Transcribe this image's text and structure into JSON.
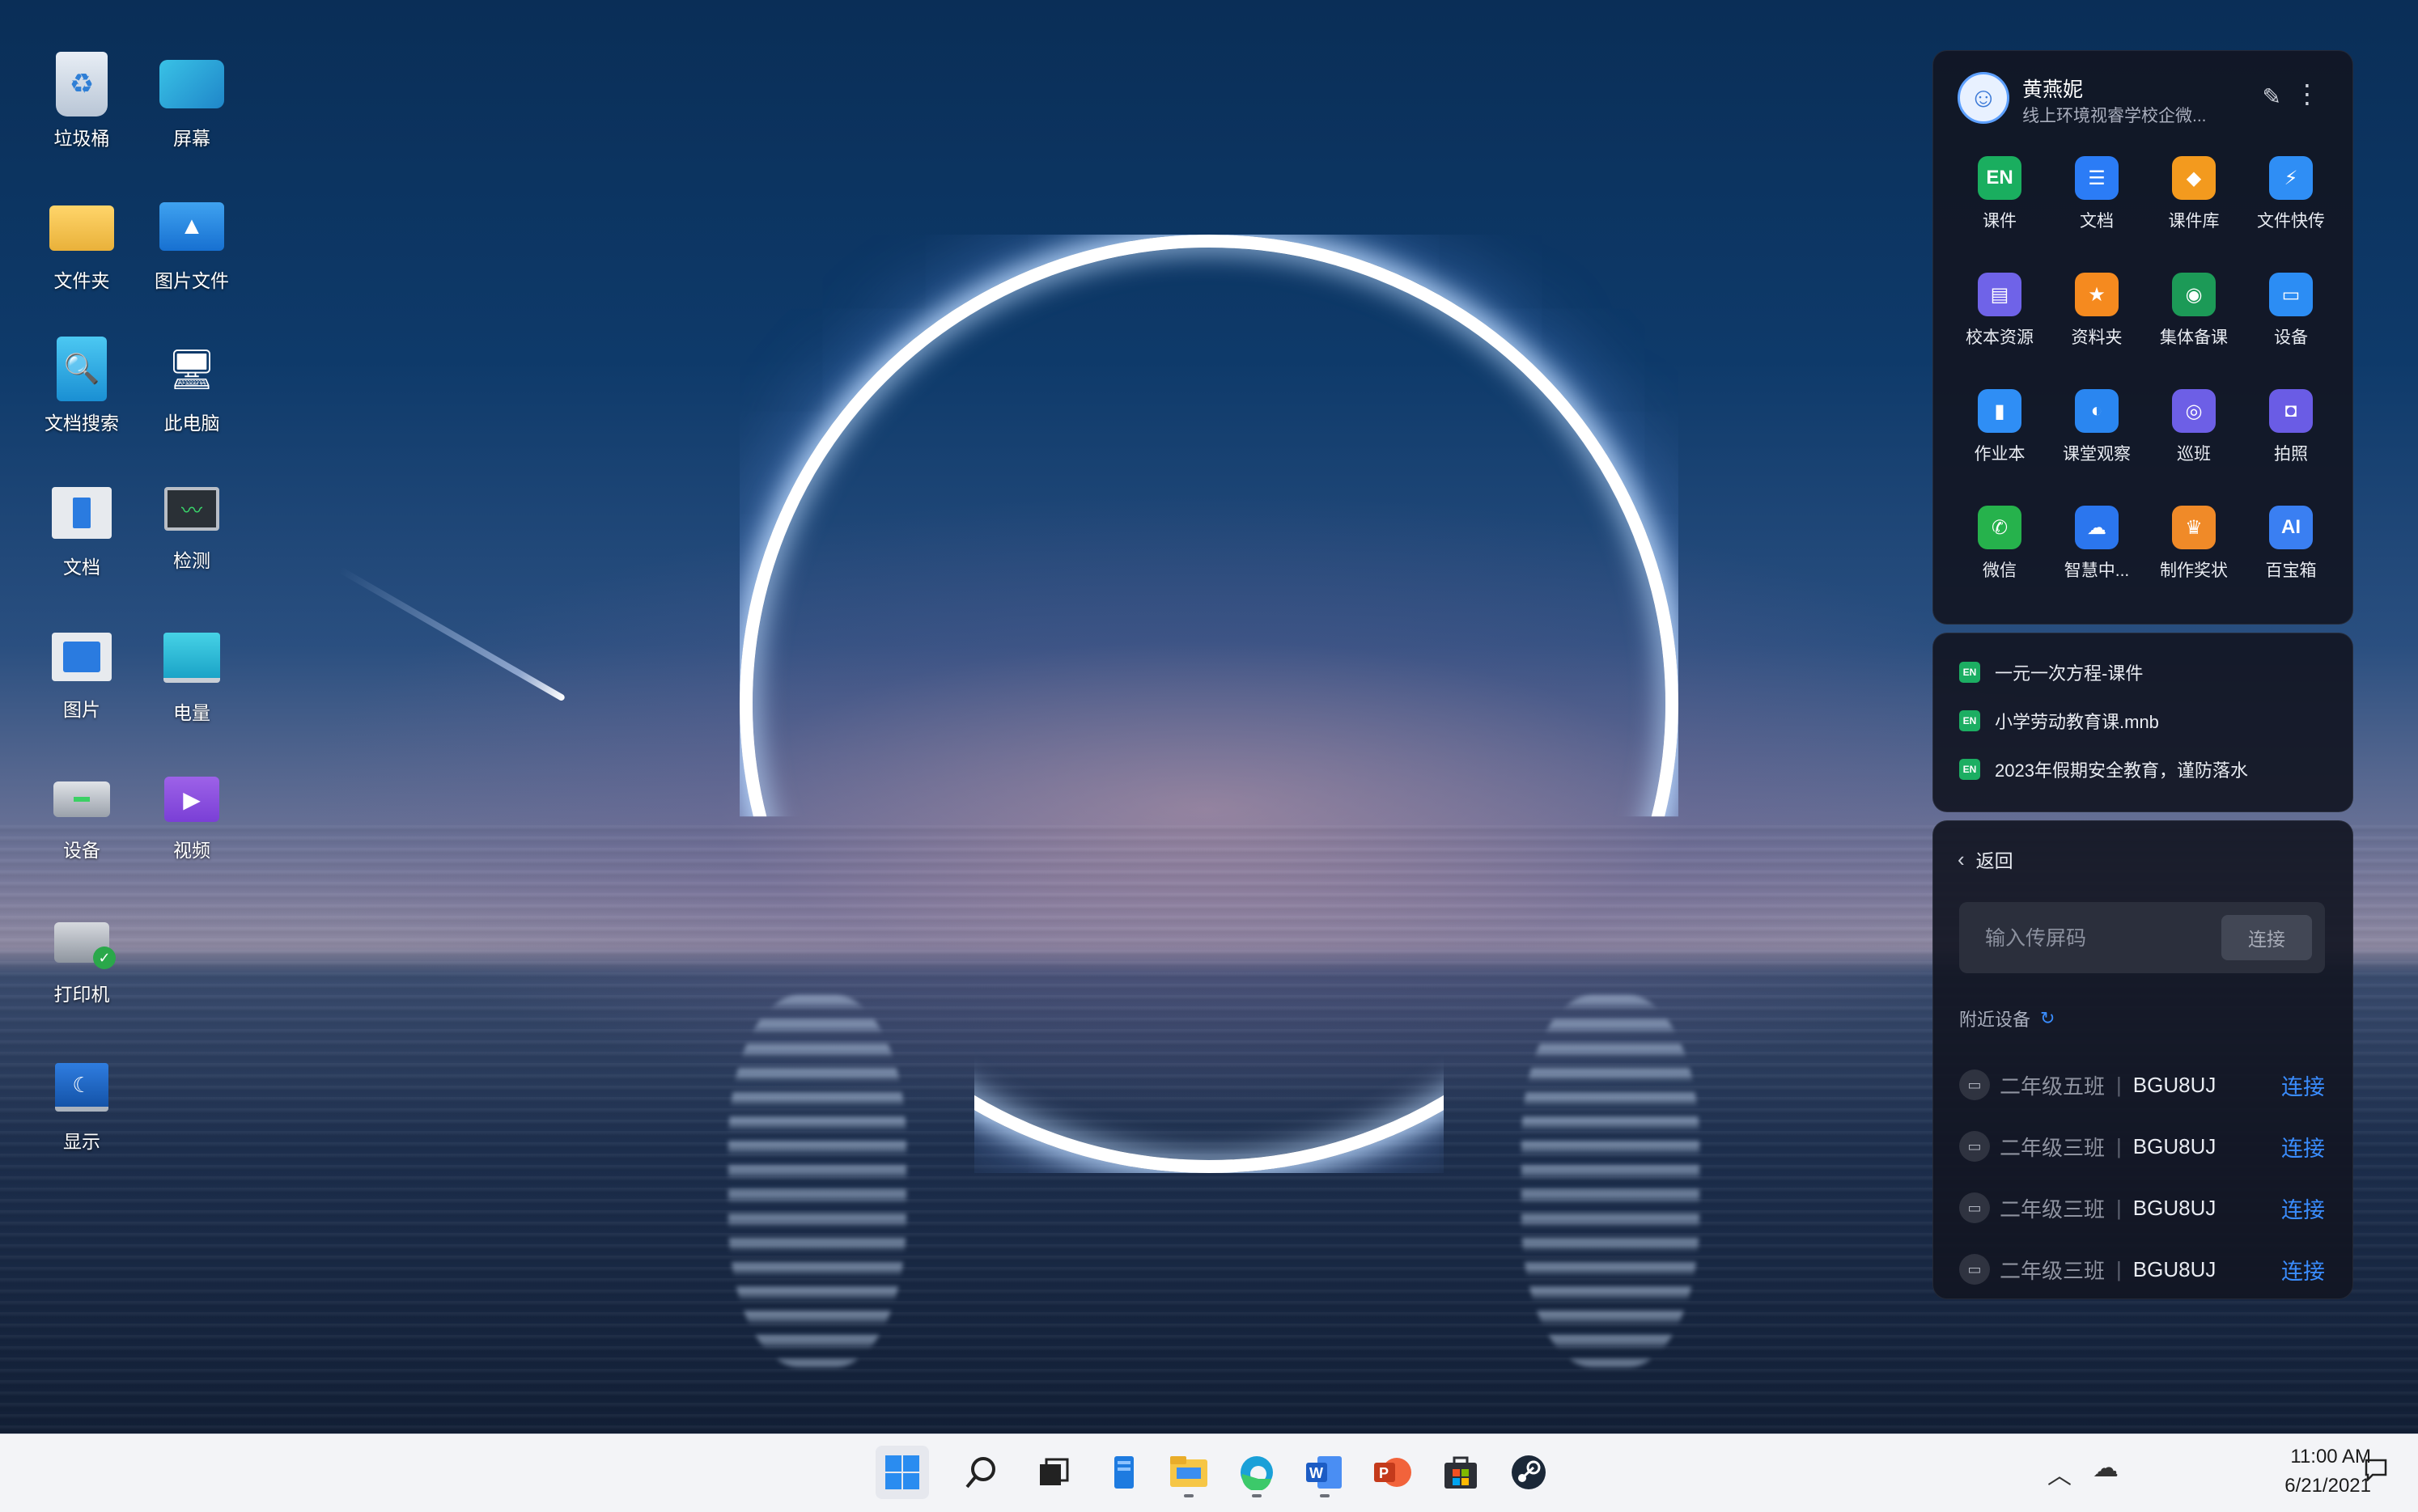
{
  "desktop_icons": [
    {
      "name": "recycle-bin",
      "label": "垃圾桶"
    },
    {
      "name": "screen",
      "label": "屏幕"
    },
    {
      "name": "folder",
      "label": "文件夹"
    },
    {
      "name": "pictures-folder",
      "label": "图片文件"
    },
    {
      "name": "doc-search",
      "label": "文档搜索"
    },
    {
      "name": "this-pc",
      "label": "此电脑"
    },
    {
      "name": "document",
      "label": "文档"
    },
    {
      "name": "monitor",
      "label": "检测"
    },
    {
      "name": "picture",
      "label": "图片"
    },
    {
      "name": "battery",
      "label": "电量"
    },
    {
      "name": "device",
      "label": "设备"
    },
    {
      "name": "video",
      "label": "视频"
    },
    {
      "name": "printer",
      "label": "打印机"
    },
    {
      "name": "display",
      "label": "显示"
    }
  ],
  "user": {
    "name": "黄燕妮",
    "org": "线上环境视睿学校企微...",
    "apps": [
      {
        "label": "课件",
        "glyph": "EN",
        "color": "#1aae5f"
      },
      {
        "label": "文档",
        "glyph": "☰",
        "color": "#2b7cf6"
      },
      {
        "label": "课件库",
        "glyph": "◆",
        "color": "#f39a1e"
      },
      {
        "label": "文件快传",
        "glyph": "⚡",
        "color": "#2f8ef5"
      },
      {
        "label": "校本资源",
        "glyph": "▤",
        "color": "#6f63e8"
      },
      {
        "label": "资料夹",
        "glyph": "★",
        "color": "#f58a1f"
      },
      {
        "label": "集体备课",
        "glyph": "◉",
        "color": "#1c9a57"
      },
      {
        "label": "设备",
        "glyph": "▭",
        "color": "#2c8df4"
      },
      {
        "label": "作业本",
        "glyph": "▮",
        "color": "#2f8ef5"
      },
      {
        "label": "课堂观察",
        "glyph": "◐",
        "color": "#2a86f0"
      },
      {
        "label": "巡班",
        "glyph": "◎",
        "color": "#6d5fe6"
      },
      {
        "label": "拍照",
        "glyph": "◘",
        "color": "#6a5ce5"
      },
      {
        "label": "微信",
        "glyph": "✆",
        "color": "#26b24c"
      },
      {
        "label": "智慧中...",
        "glyph": "☁",
        "color": "#2b76ee"
      },
      {
        "label": "制作奖状",
        "glyph": "♛",
        "color": "#f08a28"
      },
      {
        "label": "百宝箱",
        "glyph": "AI",
        "color": "#3a7ff2"
      }
    ]
  },
  "recent_files": [
    {
      "badge": "EN",
      "label": "一元一次方程-课件"
    },
    {
      "badge": "EN",
      "label": "小学劳动教育课.mnb"
    },
    {
      "badge": "EN",
      "label": "2023年假期安全教育，谨防落水"
    }
  ],
  "cast": {
    "back_label": "返回",
    "code_placeholder": "输入传屏码",
    "code_connect_label": "连接",
    "nearby_label": "附近设备",
    "devices": [
      {
        "class": "二年级五班",
        "code": "BGU8UJ",
        "connect": "连接"
      },
      {
        "class": "二年级三班",
        "code": "BGU8UJ",
        "connect": "连接"
      },
      {
        "class": "二年级三班",
        "code": "BGU8UJ",
        "connect": "连接"
      },
      {
        "class": "二年级三班",
        "code": "BGU8UJ",
        "connect": "连接"
      }
    ],
    "accent_color": "#3a8dff"
  },
  "taskbar": {
    "apps": [
      "start",
      "search",
      "task-view",
      "widgets",
      "file-explorer",
      "edge",
      "word",
      "powerpoint",
      "store",
      "steam"
    ],
    "time": "11:00 AM",
    "date": "6/21/2021"
  }
}
